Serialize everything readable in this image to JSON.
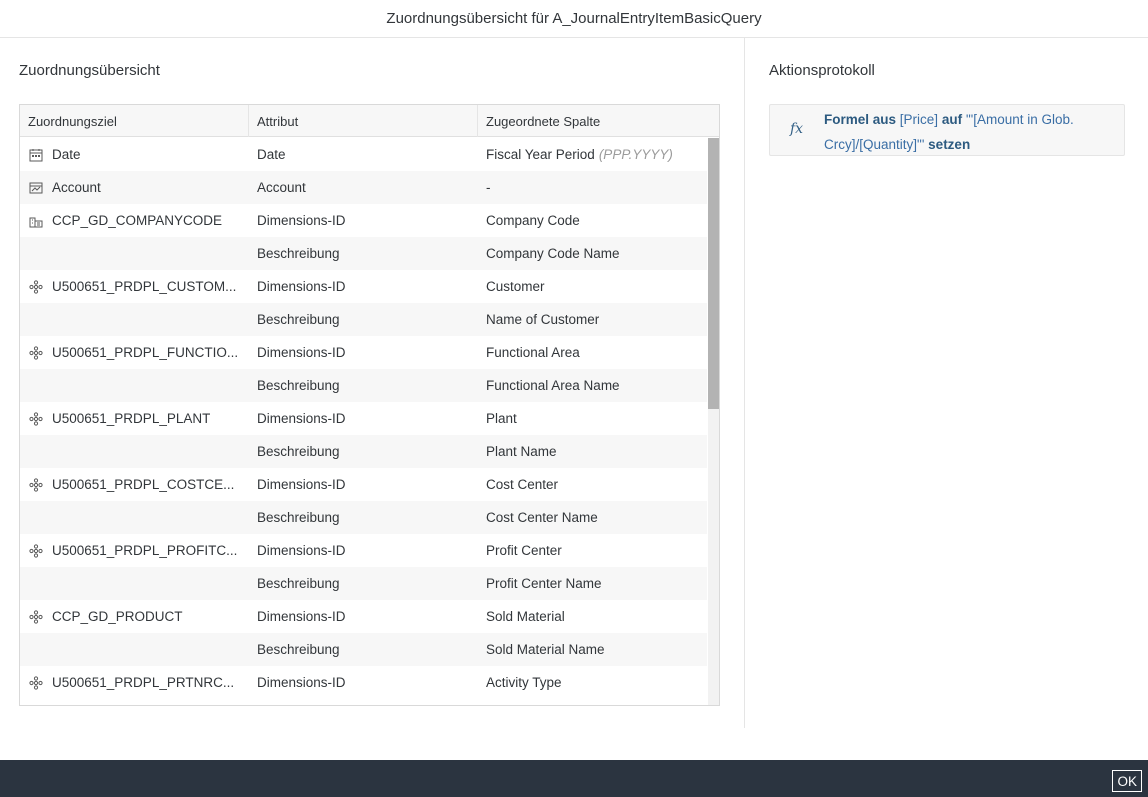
{
  "dialog": {
    "title": "Zuordnungsübersicht für A_JournalEntryItemBasicQuery"
  },
  "mapping": {
    "title": "Zuordnungsübersicht",
    "headers": {
      "target": "Zuordnungsziel",
      "attribute": "Attribut",
      "column": "Zugeordnete Spalte"
    },
    "rows": [
      {
        "icon": "calendar-icon",
        "target": "Date",
        "attribute": "Date",
        "column": "Fiscal Year Period",
        "hint": "(PPP.YYYY)"
      },
      {
        "icon": "account-icon",
        "target": "Account",
        "attribute": "Account",
        "column": "-"
      },
      {
        "icon": "company-icon",
        "target": "CCP_GD_COMPANYCODE",
        "attribute": "Dimensions-ID",
        "column": "Company Code"
      },
      {
        "icon": "",
        "target": "",
        "attribute": "Beschreibung",
        "column": "Company Code Name"
      },
      {
        "icon": "dimension-icon",
        "target": "U500651_PRDPL_CUSTOM...",
        "attribute": "Dimensions-ID",
        "column": "Customer"
      },
      {
        "icon": "",
        "target": "",
        "attribute": "Beschreibung",
        "column": "Name of Customer"
      },
      {
        "icon": "dimension-icon",
        "target": "U500651_PRDPL_FUNCTIO...",
        "attribute": "Dimensions-ID",
        "column": "Functional Area"
      },
      {
        "icon": "",
        "target": "",
        "attribute": "Beschreibung",
        "column": "Functional Area Name"
      },
      {
        "icon": "dimension-icon",
        "target": "U500651_PRDPL_PLANT",
        "attribute": "Dimensions-ID",
        "column": "Plant"
      },
      {
        "icon": "",
        "target": "",
        "attribute": "Beschreibung",
        "column": "Plant Name"
      },
      {
        "icon": "dimension-icon",
        "target": "U500651_PRDPL_COSTCE...",
        "attribute": "Dimensions-ID",
        "column": "Cost Center"
      },
      {
        "icon": "",
        "target": "",
        "attribute": "Beschreibung",
        "column": "Cost Center Name"
      },
      {
        "icon": "dimension-icon",
        "target": "U500651_PRDPL_PROFITC...",
        "attribute": "Dimensions-ID",
        "column": "Profit Center"
      },
      {
        "icon": "",
        "target": "",
        "attribute": "Beschreibung",
        "column": "Profit Center Name"
      },
      {
        "icon": "dimension-icon",
        "target": "CCP_GD_PRODUCT",
        "attribute": "Dimensions-ID",
        "column": "Sold Material"
      },
      {
        "icon": "",
        "target": "",
        "attribute": "Beschreibung",
        "column": "Sold Material Name"
      },
      {
        "icon": "dimension-icon",
        "target": "U500651_PRDPL_PRTNRC...",
        "attribute": "Dimensions-ID",
        "column": "Activity Type"
      }
    ]
  },
  "log": {
    "title": "Aktionsprotokoll",
    "entries": [
      {
        "icon": "fx-icon",
        "icon_text": "fx",
        "t1": "Formel aus",
        "t2": "[Price]",
        "t3": "auf",
        "t4": "'\"[Amount in Glob. Crcy]/[Quantity]\"'",
        "t5": "setzen"
      }
    ]
  },
  "footer": {
    "ok_label": "OK"
  },
  "colors": {
    "footer_bg": "#2b3440",
    "link": "#346187",
    "alt_row": "#f7f7f7"
  }
}
